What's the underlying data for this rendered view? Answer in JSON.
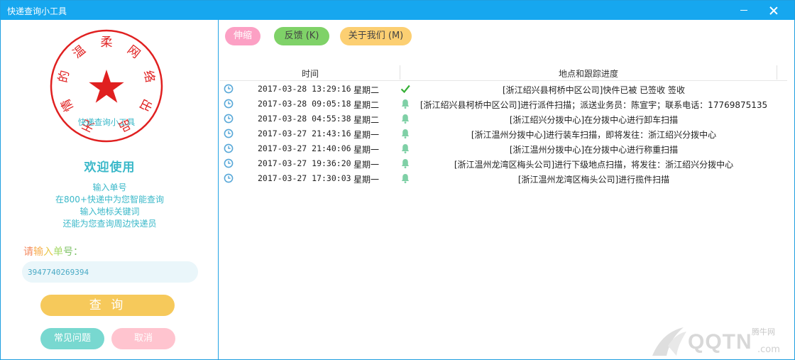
{
  "window": {
    "title": "快递查询小工具"
  },
  "seal": {
    "ring_text": "无情的温柔网络出品",
    "center_text": "快递查询小工具",
    "color": "#e02020"
  },
  "left": {
    "welcome": "欢迎使用",
    "hints": [
      "输入单号",
      "在800+快递中为您智能查询",
      "输入地标关键词",
      "还能为您查询周边快递员"
    ],
    "prompt_chars": [
      "请",
      "输",
      "入",
      "单",
      "号",
      "："
    ],
    "input_value": "3947740269394",
    "query_button": "查 询",
    "faq_button": "常见问题",
    "cancel_button": "取消"
  },
  "toolbar": {
    "shrink": "伸缩",
    "feedback": "反馈 (K)",
    "about": "关于我们 (M)"
  },
  "table": {
    "headers": {
      "time": "时间",
      "location": "地点和跟踪进度"
    },
    "rows": [
      {
        "time": "2017-03-28 13:29:16",
        "weekday": "星期二",
        "status": "check",
        "desc": "[浙江绍兴县柯桥中区公司]快件已被 已签收 签收"
      },
      {
        "time": "2017-03-28 09:05:18",
        "weekday": "星期二",
        "status": "bell",
        "desc": "[浙江绍兴县柯桥中区公司]进行派件扫描；派送业务员：陈宣宇；联系电话：17769875135"
      },
      {
        "time": "2017-03-28 04:55:38",
        "weekday": "星期二",
        "status": "bell",
        "desc": "[浙江绍兴分拨中心]在分拨中心进行卸车扫描"
      },
      {
        "time": "2017-03-27 21:43:16",
        "weekday": "星期一",
        "status": "bell",
        "desc": "[浙江温州分拨中心]进行装车扫描，即将发往：浙江绍兴分拨中心"
      },
      {
        "time": "2017-03-27 21:40:06",
        "weekday": "星期一",
        "status": "bell",
        "desc": "[浙江温州分拨中心]在分拨中心进行称重扫描"
      },
      {
        "time": "2017-03-27 19:36:20",
        "weekday": "星期一",
        "status": "bell",
        "desc": "[浙江温州龙湾区梅头公司]进行下级地点扫描，将发往：浙江绍兴分拨中心"
      },
      {
        "time": "2017-03-27 17:30:03",
        "weekday": "星期一",
        "status": "bell",
        "desc": "[浙江温州龙湾区梅头公司]进行揽件扫描"
      }
    ]
  },
  "watermark": {
    "brand": "QQTN",
    "sub": "腾牛网",
    "suffix": ".com"
  },
  "colors": {
    "titlebar": "#16a7ef",
    "accent_teal": "#3ab8c9",
    "check_green": "#35b035",
    "bell_green": "#7fd0a6",
    "clock_blue": "#58a8d8"
  }
}
